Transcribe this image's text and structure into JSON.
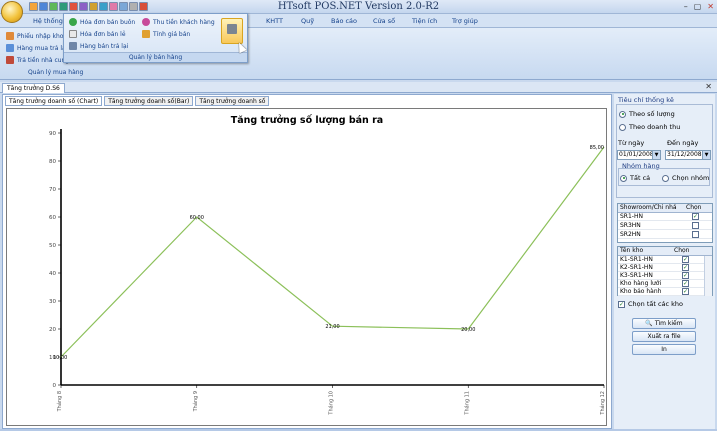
{
  "app": {
    "title": "HTsoft POS.NET Version 2.0-R2",
    "window_controls": [
      "–",
      "▢",
      "✕"
    ]
  },
  "ribbon": {
    "tabs": [
      "Hệ thống",
      "KHTT",
      "Quỹ",
      "Báo cáo",
      "Cửa sổ",
      "Tiện ích",
      "Trợ giúp"
    ],
    "left_items": [
      "Phiếu nhập kho",
      "Hàng mua trả lại",
      "Trả tiền nhà cung"
    ],
    "left_group_label": "Quản lý mua hàng",
    "dropdown": {
      "items_col1": [
        "Hóa đơn bán buôn",
        "Hóa đơn bán lẻ",
        "Hàng bán trả lại"
      ],
      "items_col2": [
        "Thu tiền khách hàng",
        "Tính giá bán"
      ],
      "group_label": "Quản lý bán hàng"
    }
  },
  "doc_tab": {
    "label": "Tăng trưởng D.S6",
    "close": "✕"
  },
  "sub_tabs": [
    "Tăng trưởng doanh số (Chart)",
    "Tăng trưởng doanh số(Bar)",
    "Tăng trưởng doanh số"
  ],
  "chart_data": {
    "type": "line",
    "title": "Tăng trưởng số lượng bán ra",
    "categories": [
      "Tháng 8",
      "Tháng 9",
      "Tháng 10",
      "Tháng 11",
      "Tháng 12"
    ],
    "series": [
      {
        "values": [
          10,
          60,
          21,
          20,
          85
        ]
      }
    ],
    "data_labels": [
      "10,00",
      "60,00",
      "21,00",
      "20,00",
      "85,00"
    ],
    "ylim": [
      0,
      90
    ],
    "yticks": [
      0,
      10,
      20,
      30,
      40,
      50,
      60,
      70,
      80,
      90
    ],
    "line_color": "#8cc05a"
  },
  "panel": {
    "title": "Tiêu chí thống kê",
    "radio_qty": "Theo số lượng",
    "radio_revenue": "Theo doanh thu",
    "from_label": "Từ ngày",
    "to_label": "Đến ngày",
    "from_value": "01/01/2008",
    "to_value": "31/12/2008",
    "group_title": "Nhóm hàng",
    "radio_all": "Tất cả",
    "radio_pick": "Chọn nhóm",
    "showroom_header": "Showroom/Chi nhá",
    "pick_header": "Chọn",
    "showrooms": [
      "SR1-HN",
      "SR3HN",
      "SR2HN"
    ],
    "showroom_checked": [
      true,
      false,
      false
    ],
    "warehouse_header": "Tên kho",
    "warehouses": [
      "K1-SR1-HN",
      "K2-SR1-HN",
      "K3-SR1-HN",
      "Kho hàng lưới",
      "Kho bảo hành"
    ],
    "warehouse_checked": [
      true,
      true,
      true,
      true,
      true
    ],
    "select_all_label": "Chọn tất các kho",
    "btn_search": "Tìm kiếm",
    "btn_export": "Xuất ra file",
    "btn_print": "In"
  }
}
